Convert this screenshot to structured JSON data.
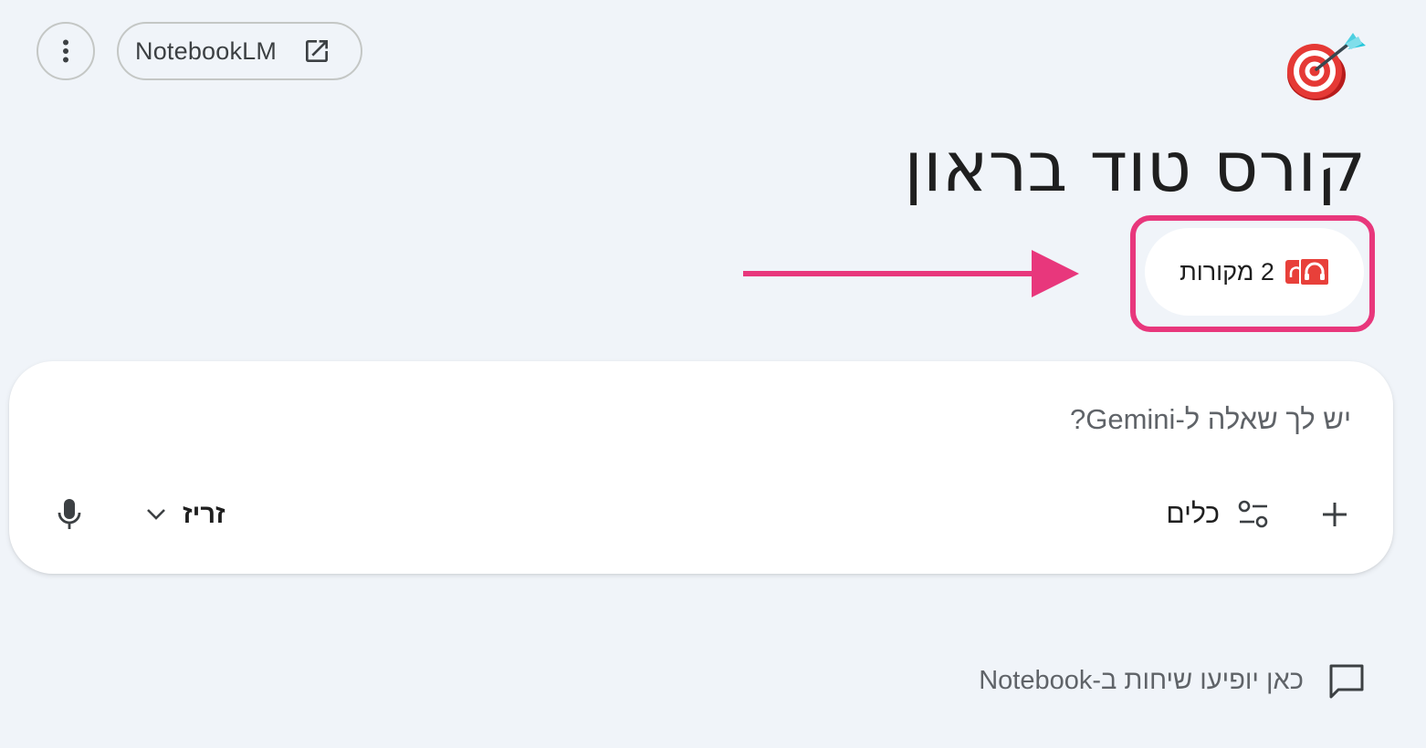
{
  "header": {
    "more_label": "",
    "notebooklm_label": "NotebookLM"
  },
  "notebook": {
    "emoji": "🎯",
    "title": "קורס טוד בראון",
    "sources_label": "2 מקורות"
  },
  "prompt": {
    "placeholder": "יש לך שאלה ל-Gemini?",
    "tools_label": "כלים",
    "model_label": "זריז"
  },
  "chat_hint": {
    "text": "כאן יופיעו שיחות ב-Notebook"
  },
  "colors": {
    "background": "#f0f4f9",
    "highlight": "#e8377c",
    "source_icon": "#e8403a"
  }
}
